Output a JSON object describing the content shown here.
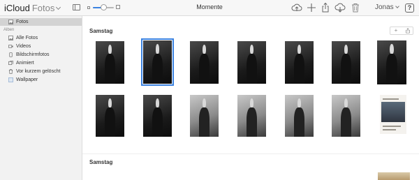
{
  "app": {
    "brand": "iCloud",
    "app_name": "Fotos",
    "view_title": "Momente"
  },
  "toolbar": {
    "zoom_level": 0.5,
    "icons": [
      "cloud-upload-icon",
      "plus-icon",
      "share-icon",
      "cloud-download-icon",
      "trash-icon"
    ],
    "user_name": "Jonas",
    "help_label": "?"
  },
  "sidebar": {
    "top_item": {
      "label": "Fotos",
      "icon": "photos-icon"
    },
    "albums_heading": "Alben",
    "items": [
      {
        "label": "Alle Fotos",
        "icon": "all-photos-icon"
      },
      {
        "label": "Videos",
        "icon": "video-icon"
      },
      {
        "label": "Bildschirmfotos",
        "icon": "screenshot-icon"
      },
      {
        "label": "Animiert",
        "icon": "animated-icon"
      },
      {
        "label": "Vor kurzem gelöscht",
        "icon": "trash-icon"
      },
      {
        "label": "Wallpaper",
        "icon": "album-icon"
      }
    ]
  },
  "sections": [
    {
      "title": "Samstag",
      "actions": [
        "+",
        "share"
      ]
    },
    {
      "title": "Samstag"
    }
  ],
  "colors": {
    "accent": "#3b82e0",
    "sidebar_bg": "#f2f2f2",
    "toolbar_bg": "#f7f7f7"
  }
}
